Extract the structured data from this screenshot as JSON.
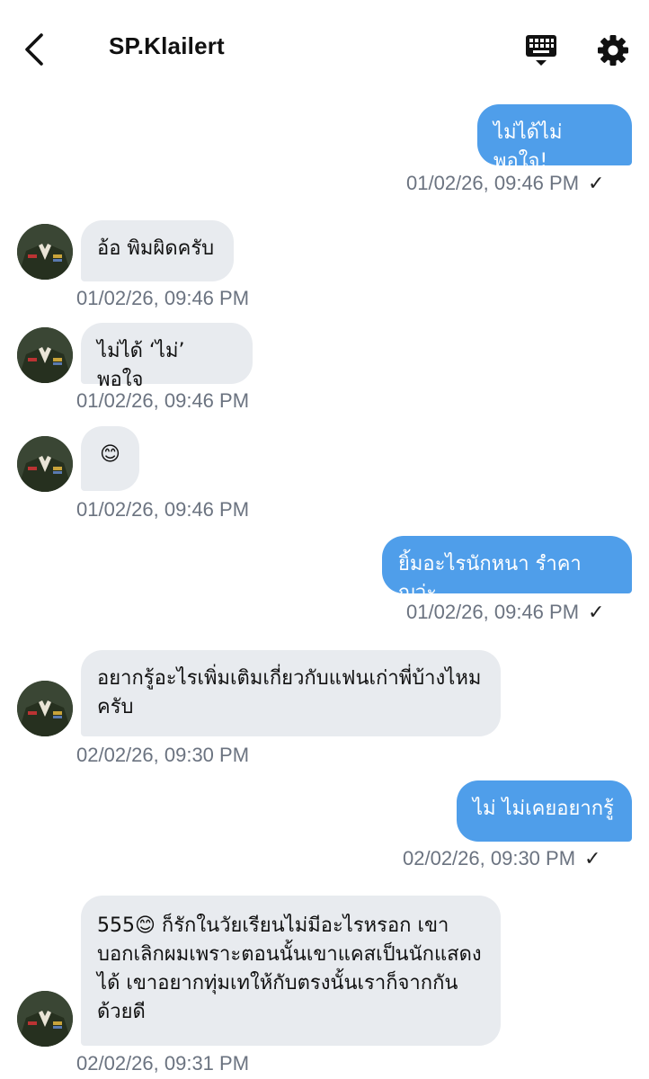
{
  "header": {
    "title": "SP.Klailert"
  },
  "messages": [
    {
      "text": "ไม่ได้ไม่พอใจ!",
      "time": "01/02/26, 09:46 PM",
      "check": "✓"
    },
    {
      "text": "อ้อ พิมผิดครับ",
      "time": "01/02/26, 09:46 PM"
    },
    {
      "text": "ไม่ได้ ‘ไม่’ พอใจ",
      "time": "01/02/26, 09:46 PM"
    },
    {
      "text": "😊",
      "time": "01/02/26, 09:46 PM"
    },
    {
      "text": "ยิ้มอะไรนักหนา รำคาญว่ะ",
      "time": "01/02/26, 09:46 PM",
      "check": "✓"
    },
    {
      "text": "อยากรู้อะไรเพิ่มเติมเกี่ยวกับแฟนเก่าพี่บ้างไหมครับ",
      "time": "02/02/26, 09:30 PM"
    },
    {
      "text": "ไม่ ไม่เคยอยากรู้",
      "time": "02/02/26, 09:30 PM",
      "check": "✓"
    },
    {
      "text": "555😊 ก็รักในวัยเรียนไม่มีอะไรหรอก เขาบอกเลิกผมเพราะตอนนั้นเขาแคสเป็นนักแสดงได้ เขาอยากทุ่มเทให้กับตรงนั้นเราก็จากกันด้วยดี",
      "time": "02/02/26, 09:31 PM"
    }
  ]
}
